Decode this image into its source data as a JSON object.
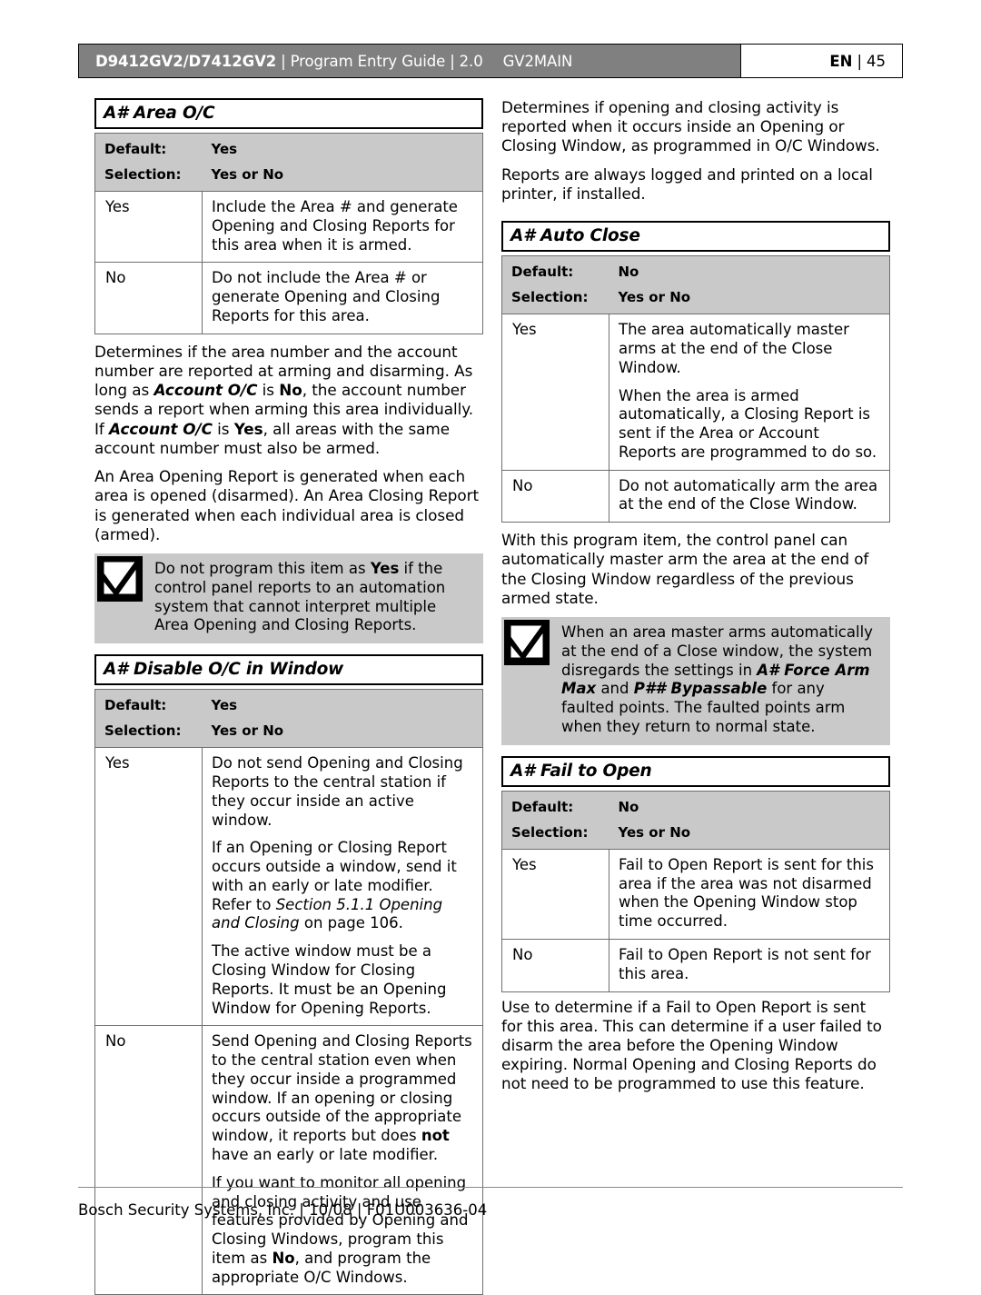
{
  "header": {
    "model": "D9412GV2/D7412GV2",
    "guide": "Program Entry Guide",
    "version": "2.0",
    "module": "GV2MAIN",
    "lang": "EN",
    "page": "45",
    "separator": "|"
  },
  "footer": {
    "text": "Bosch Security Systems, Inc. | 10/08 | F01U003636-04"
  },
  "labels": {
    "default": "Default:",
    "selection": "Selection:"
  },
  "sections": {
    "area_oc": {
      "title": "A# Area O/C",
      "default": "Yes",
      "selection": "Yes or No",
      "rows": [
        {
          "key": "Yes",
          "text": "Include the Area # and generate Opening and Closing Reports for this area when it is armed."
        },
        {
          "key": "No",
          "text": "Do not include the Area # or generate Opening and Closing Reports for this area."
        }
      ],
      "paragraph1_a": "Determines if the area number and the account number are reported at arming and disarming. As long as ",
      "paragraph1_b": "Account O/C",
      "paragraph1_c": " is ",
      "paragraph1_d": "No",
      "paragraph1_e": ", the account number sends a report when arming this area individually. If ",
      "paragraph1_f": "Account O/C",
      "paragraph1_g": " is ",
      "paragraph1_h": "Yes",
      "paragraph1_i": ", all areas with the same account number must also be armed.",
      "paragraph2": "An Area Opening Report is generated when each area is opened (disarmed). An Area Closing Report is generated when each individual area is closed (armed).",
      "notice_a": "Do not program this item as ",
      "notice_b": "Yes",
      "notice_c": " if the control panel reports to an automation system that cannot interpret multiple Area Opening and Closing Reports."
    },
    "disable_oc": {
      "title": "A# Disable O/C in Window",
      "default": "Yes",
      "selection": "Yes or No",
      "yes_key": "Yes",
      "yes_p1": "Do not send Opening and Closing Reports to the central station if they occur inside an active window.",
      "yes_p2_a": "If an Opening or Closing Report occurs outside a window, send it with an early or late modifier. Refer to ",
      "yes_p2_b": "Section 5.1.1 Opening and Closing",
      "yes_p2_c": " on page 106.",
      "yes_p3": "The active window must be a Closing Window for Closing Reports. It must be an Opening Window for Opening Reports.",
      "no_key": "No",
      "no_p1_a": "Send Opening and Closing Reports to the central station even when they occur inside a programmed window. If an opening or closing occurs outside of the appropriate window, it reports but does ",
      "no_p1_b": "not",
      "no_p1_c": " have an early or late modifier.",
      "no_p2_a": "If you want to monitor all opening and closing activity and use features provided by Opening and Closing Windows, program this item as ",
      "no_p2_b": "No",
      "no_p2_c": ", and program the appropriate O/C Windows."
    },
    "auto_close": {
      "intro1": "Determines if opening and closing activity is reported when it occurs inside an Opening or Closing Window, as programmed in O/C Windows.",
      "intro2": "Reports are always logged and printed on a local printer, if installed.",
      "title": "A# Auto Close",
      "default": "No",
      "selection": "Yes or No",
      "yes_key": "Yes",
      "yes_p1": "The area automatically master arms at the end of the Close Window.",
      "yes_p2": "When the area is armed automatically, a Closing Report is sent if the Area or Account Reports are programmed to do so.",
      "no_key": "No",
      "no_p1": "Do not automatically arm the area at the end of the Close Window.",
      "paragraph": "With this program item, the control panel can automatically master arm the area at the end of the Closing Window regardless of the previous armed state.",
      "notice_a": "When an area master arms automatically at the end of a Close window, the system disregards the settings in ",
      "notice_b": "A# Force Arm Max",
      "notice_c": " and ",
      "notice_d": "P## Bypassable",
      "notice_e": " for any faulted points. The faulted points arm when they return to normal state."
    },
    "fail_to_open": {
      "title": "A# Fail to Open",
      "default": "No",
      "selection": "Yes or No",
      "rows": [
        {
          "key": "Yes",
          "text": "Fail to Open Report is sent for this area if the area was not disarmed when the Opening Window stop time occurred."
        },
        {
          "key": "No",
          "text": "Fail to Open Report is not sent for this area."
        }
      ],
      "paragraph": "Use to determine if a Fail to Open Report is sent for this area. This can determine if a user failed to disarm the area before the Opening Window expiring. Normal Opening and Closing Reports do not need to be programmed to use this feature."
    }
  }
}
